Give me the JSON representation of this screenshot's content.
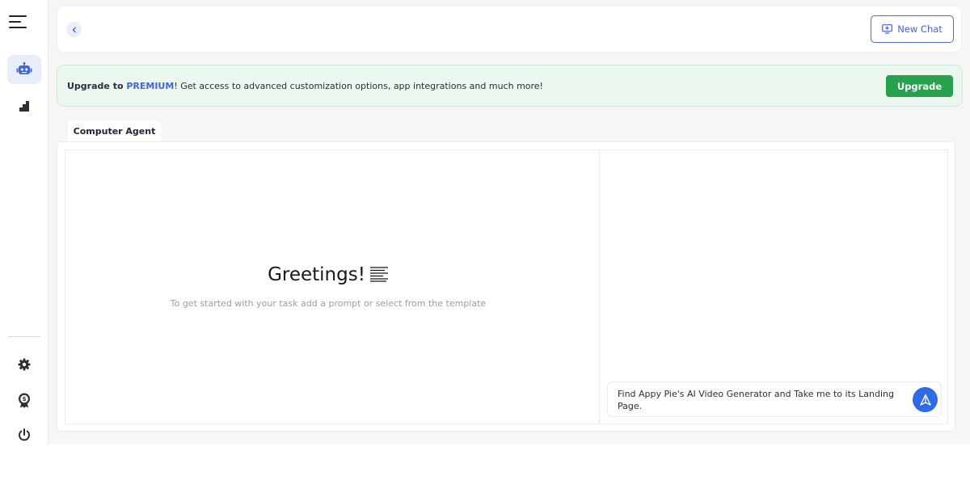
{
  "sidebar": {
    "items": [
      {
        "icon": "menu-icon"
      },
      {
        "icon": "robot-icon",
        "active": true
      },
      {
        "icon": "stairs-chart-icon"
      },
      {
        "icon": "gear-icon"
      },
      {
        "icon": "award-badge-icon"
      },
      {
        "icon": "power-icon"
      }
    ]
  },
  "header": {
    "back_icon": "chevron-left-icon",
    "new_chat_label": "New Chat",
    "new_chat_icon": "add-monitor-icon"
  },
  "banner": {
    "prefix": "Upgrade to ",
    "premium": "PREMIUM",
    "suffix": "! Get access to advanced customization options, app integrations and much more!",
    "button_label": "Upgrade"
  },
  "tabs": [
    {
      "label": "Computer Agent",
      "active": true
    }
  ],
  "main": {
    "greeting": "Greetings!",
    "subtitle": "To get started with your task add a prompt or select from the template",
    "prompt_text": "Find Appy Pie's AI Video Generator and Take me to its Landing Page.",
    "send_icon": "send-arrow-icon"
  },
  "colors": {
    "accent": "#2f6be6",
    "premium": "#3f67d9",
    "upgrade": "#27a14e",
    "banner_bg": "#eaf6ee"
  }
}
